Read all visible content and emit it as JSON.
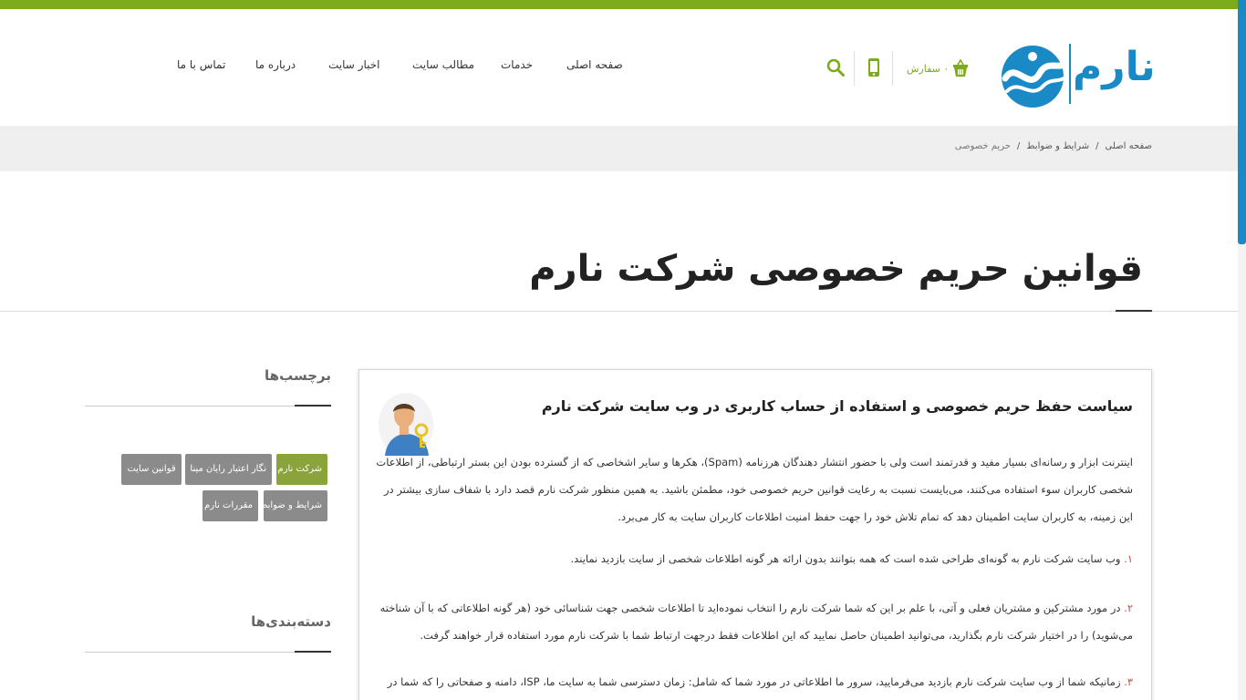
{
  "header": {
    "logo_text": "نارم",
    "cart_label": "۰ سفارش",
    "nav": [
      {
        "label": "صفحه اصلی"
      },
      {
        "label": "خدمات"
      },
      {
        "label": "مطالب سایت"
      },
      {
        "label": "اخبار سایت"
      },
      {
        "label": "درباره ما"
      },
      {
        "label": "تماس با ما"
      }
    ]
  },
  "breadcrumb": {
    "items": [
      "صفحه اصلی",
      "شرایط و ضوابط",
      "حریم خصوصی"
    ],
    "separator": "/"
  },
  "page": {
    "title": "قوانین حریم خصوصی شرکت نارم"
  },
  "article": {
    "title": "سیاست حفظ حریم خصوصی و استفاده از حساب کاربری در وب سایت شرکت نارم",
    "intro": "اینترنت ابزار و رسانه‌ای بسیار مفید و قدرتمند است ولی با حضور انتشار دهندگان هرزنامه (Spam)، هکرها و سایر اشخاصی که از گسترده بودن این بستر ارتباطی، از اطلاعات شخصی کاربران سوء استفاده می‌کنند، می‌بایست نسبت به رعایت قوانین حریم خصوصی خود، مطمئن باشید. به همین منظور شرکت نارم قصد دارد با شفاف سازی بیشتر در این زمینه، به کاربران سایت اطمینان دهد که تمام تلاش خود را جهت حفظ امنیت اطلاعات کاربران سایت به کار می‌برد.",
    "items": [
      {
        "num": "۱.",
        "text": " وب سایت شرکت نارم به گونه‌ای طراحی شده است که همه بتوانند بدون ارائه هر گونه اطلاعات شخصی از سایت بازدید نمایند."
      },
      {
        "num": "۲.",
        "text": " در مورد مشترکین و مشتریان فعلی و آتی، با علم بر این که شما شرکت نارم را انتخاب نموده‌اید تا اطلاعات شخصی جهت شناسائی خود (هر گونه اطلاعاتی که با آن شناخته می‌شوید) را در اختیار شرکت نارم بگذارید، می‌توانید اطمینان حاصل نمایید که این اطلاعات فقط درجهت ارتباط شما با شرکت نارم مورد استفاده قرار خواهند گرفت."
      },
      {
        "num": "۳.",
        "text": " زمانیکه شما از وب سایت شرکت نارم بازدید می‌فرمایید، سرور ما اطلاعاتی در مورد شما که شامل: زمان دسترسی شما به سایت ما، ISP، دامنه و صفحاتی را که شما در سایت ما"
      }
    ]
  },
  "sidebar": {
    "tags_heading": "برچسب‌ها",
    "tags": [
      {
        "label": "شرکت نارم",
        "active": true
      },
      {
        "label": "نگار اعتبار رایان مینا",
        "active": false
      },
      {
        "label": "قوانین سایت",
        "active": false
      },
      {
        "label": "شرایط و ضوابط",
        "active": false
      },
      {
        "label": "مقررات نارم",
        "active": false
      }
    ],
    "categories_heading": "دسته‌بندی‌ها"
  },
  "colors": {
    "accent_green": "#7cab1c",
    "brand_blue": "#1a8ac6",
    "tag_active": "#8aa33a",
    "tag_default": "#8b8b8b",
    "number_red": "#d9463b"
  }
}
